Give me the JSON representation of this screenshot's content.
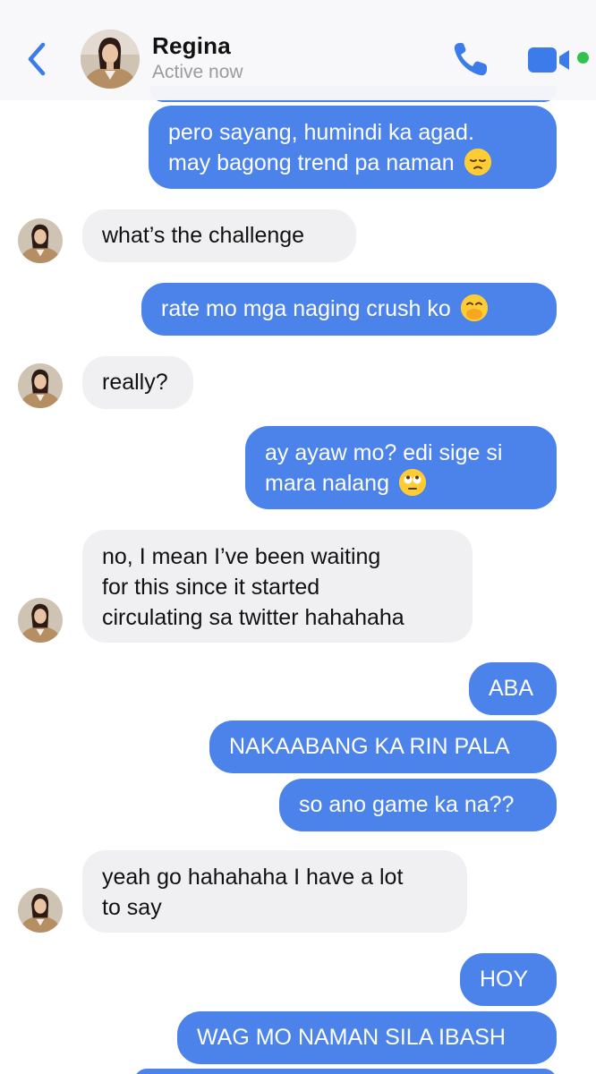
{
  "header": {
    "name": "Regina",
    "status": "Active now"
  },
  "messages": [
    {
      "sender": "me",
      "text": "pero sayang, humindi ka agad.",
      "text2": "may bagong trend pa naman",
      "emoji": "pensive-face"
    },
    {
      "sender": "Regina",
      "text": "what’s the challenge"
    },
    {
      "sender": "me",
      "text": "rate mo mga naging crush ko",
      "emoji": "face-with-hand-over-mouth"
    },
    {
      "sender": "Regina",
      "text": "really?"
    },
    {
      "sender": "me",
      "text": "ay ayaw mo? edi sige si",
      "text2": "mara nalang",
      "emoji": "face-with-rolling-eyes"
    },
    {
      "sender": "Regina",
      "text": "no, I mean I’ve been waiting",
      "text2": "for this since it started",
      "text3": "circulating sa twitter hahahaha"
    },
    {
      "sender": "me",
      "text": "ABA"
    },
    {
      "sender": "me",
      "text": "NAKAABANG KA RIN PALA"
    },
    {
      "sender": "me",
      "text": "so ano game ka na??"
    },
    {
      "sender": "Regina",
      "text": "yeah go hahahaha I have a lot",
      "text2": "to say"
    },
    {
      "sender": "me",
      "text": "HOY"
    },
    {
      "sender": "me",
      "text": "WAG MO NAMAN SILA IBASH"
    }
  ],
  "colors": {
    "sent_bubble": "#4b83ea",
    "received_bubble": "#f0f0f2",
    "accent": "#3b7bea",
    "online": "#31c24d"
  },
  "icons": [
    "chevron-left-icon",
    "phone-icon",
    "video-camera-icon"
  ]
}
